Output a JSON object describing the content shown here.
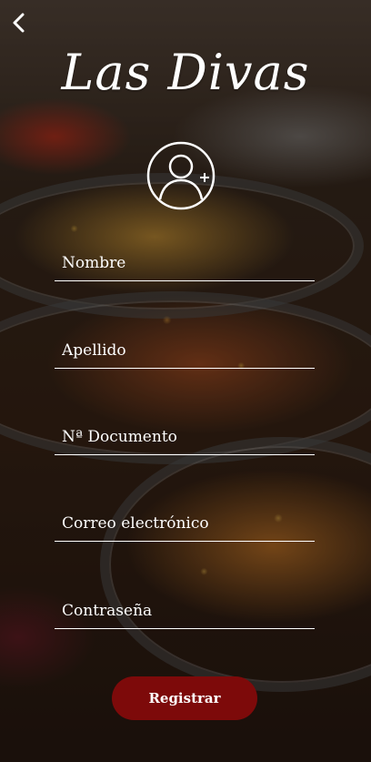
{
  "app": {
    "brand": "Las Divas"
  },
  "icons": {
    "back": "chevron-left-icon",
    "avatar": "user-add-icon"
  },
  "form": {
    "fields": [
      {
        "id": "nombre",
        "placeholder": "Nombre",
        "value": ""
      },
      {
        "id": "apellido",
        "placeholder": "Apellido",
        "value": ""
      },
      {
        "id": "documento",
        "placeholder": "Nª Documento",
        "value": ""
      },
      {
        "id": "correo",
        "placeholder": "Correo electrónico",
        "value": ""
      },
      {
        "id": "contrasena",
        "placeholder": "Contraseña",
        "value": ""
      }
    ],
    "submit_label": "Registrar"
  },
  "colors": {
    "accent": "#7d0a0a",
    "text": "#ffffff"
  }
}
